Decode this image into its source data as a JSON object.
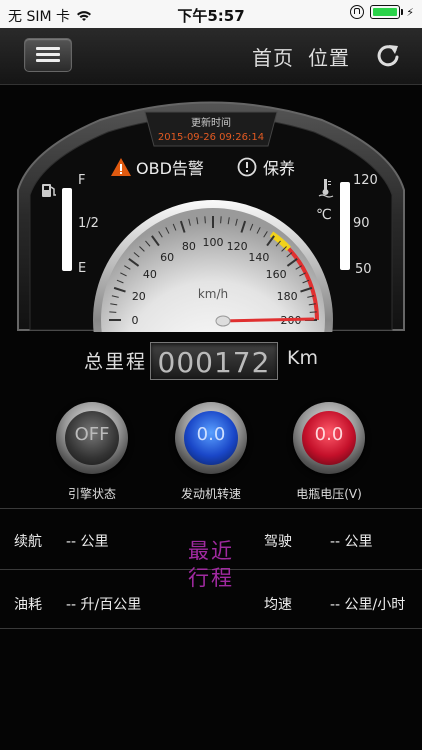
{
  "status_bar": {
    "carrier": "无 SIM 卡",
    "time": "下午5:57"
  },
  "nav": {
    "home": "首页",
    "location": "位置",
    "menu_icon": "hamburger-icon",
    "refresh_icon": "refresh-icon"
  },
  "update": {
    "label": "更新时间",
    "time": "2015-09-26 09:26:14"
  },
  "warnings": {
    "obd": "OBD告警",
    "maintenance": "保养"
  },
  "speedometer": {
    "unit": "km/h",
    "ticks": [
      "0",
      "20",
      "40",
      "60",
      "80",
      "100",
      "120",
      "140",
      "160",
      "180",
      "200"
    ],
    "speed": 0,
    "max": 200
  },
  "fuel_gauge": {
    "full": "F",
    "half": "1/2",
    "empty": "E"
  },
  "temp_gauge": {
    "unit": "℃",
    "high": "120",
    "mid": "90",
    "low": "50"
  },
  "odometer": {
    "label": "总里程",
    "value": "000172",
    "unit": "Km"
  },
  "indicators": [
    {
      "value": "OFF",
      "caption": "引擎状态"
    },
    {
      "value": "0.0",
      "caption": "发动机转速"
    },
    {
      "value": "0.0",
      "caption": "电瓶电压(V)"
    }
  ],
  "trip": {
    "title_line1": "最近",
    "title_line2": "行程",
    "range_label": "续航",
    "range_value": "-- 公里",
    "drive_label": "驾驶",
    "drive_value": "-- 公里",
    "fuel_label": "油耗",
    "fuel_value": "-- 升/百公里",
    "avg_label": "均速",
    "avg_value": "-- 公里/小时"
  },
  "colors": {
    "accent_red": "#e03030",
    "accent_yellow": "#f2d21a",
    "trip_purple": "#a02aa0",
    "update_orange": "#e25a22"
  }
}
